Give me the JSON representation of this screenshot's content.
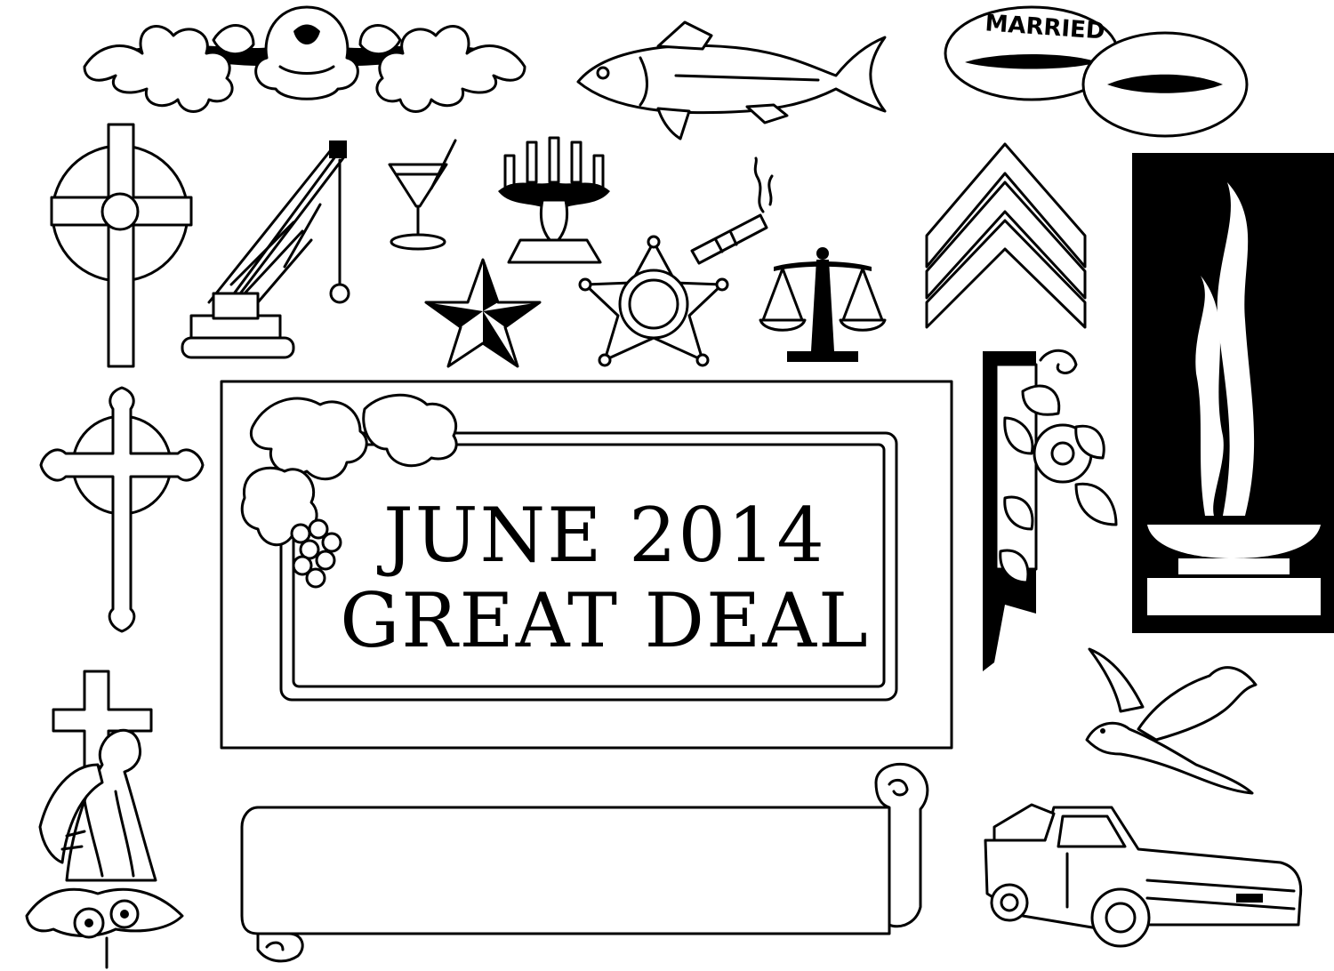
{
  "plaque": {
    "line1": "JUNE 2014",
    "line2": "GREAT DEAL"
  },
  "rings": {
    "engraving": "MARRIED"
  },
  "icons": [
    "floral-border-icon",
    "fish-icon",
    "wedding-rings-icon",
    "celtic-cross-icon",
    "crane-icon",
    "martini-icon",
    "candelabra-icon",
    "cigar-icon",
    "star-icon",
    "sheriff-badge-icon",
    "scales-of-justice-icon",
    "chevron-rank-icon",
    "eternal-flame-icon",
    "fleury-cross-icon",
    "corner-flourish-icon",
    "dove-icon",
    "angel-cross-icon",
    "scroll-banner-icon",
    "pickup-truck-icon"
  ],
  "colors": {
    "ink": "#000000",
    "paper": "#ffffff"
  }
}
